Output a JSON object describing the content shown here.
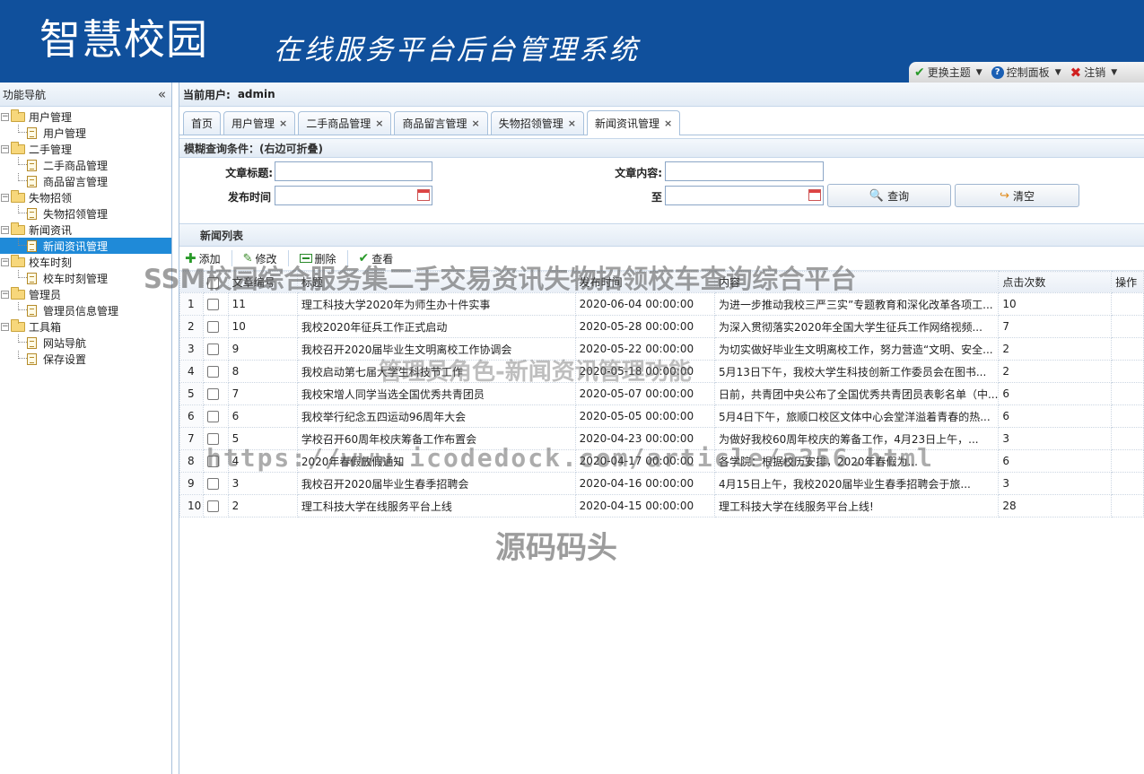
{
  "header": {
    "brand": "智慧校园",
    "subtitle": "在线服务平台后台管理系统",
    "toolbar": {
      "theme": "更换主题",
      "control_panel": "控制面板",
      "logout": "注销"
    }
  },
  "sidebar": {
    "title": "功能导航",
    "collapse": "«",
    "tree": [
      {
        "type": "group",
        "label": "用户管理"
      },
      {
        "type": "leaf",
        "label": "用户管理"
      },
      {
        "type": "group",
        "label": "二手管理"
      },
      {
        "type": "leaf",
        "label": "二手商品管理"
      },
      {
        "type": "leaf",
        "label": "商品留言管理"
      },
      {
        "type": "group",
        "label": "失物招领"
      },
      {
        "type": "leaf",
        "label": "失物招领管理"
      },
      {
        "type": "group",
        "label": "新闻资讯"
      },
      {
        "type": "leaf",
        "label": "新闻资讯管理",
        "selected": true
      },
      {
        "type": "group",
        "label": "校车时刻"
      },
      {
        "type": "leaf",
        "label": "校车时刻管理"
      },
      {
        "type": "group",
        "label": "管理员"
      },
      {
        "type": "leaf",
        "label": "管理员信息管理"
      },
      {
        "type": "group",
        "label": "工具箱"
      },
      {
        "type": "leaf",
        "label": "网站导航"
      },
      {
        "type": "leaf",
        "label": "保存设置"
      }
    ]
  },
  "userbar": {
    "label": "当前用户:",
    "user": "admin"
  },
  "tabs": [
    {
      "label": "首页",
      "closable": false
    },
    {
      "label": "用户管理",
      "closable": true
    },
    {
      "label": "二手商品管理",
      "closable": true
    },
    {
      "label": "商品留言管理",
      "closable": true
    },
    {
      "label": "失物招领管理",
      "closable": true
    },
    {
      "label": "新闻资讯管理",
      "closable": true,
      "active": true
    }
  ],
  "search": {
    "title": "模糊查询条件：(右边可折叠)",
    "title_label": "文章标题:",
    "title_value": "",
    "content_label": "文章内容:",
    "content_value": "",
    "date_label": "发布时间",
    "date_from": "",
    "to_label": "至",
    "date_to": "",
    "query_button": "查询",
    "clear_button": "清空"
  },
  "list": {
    "title": "新闻列表",
    "toolbar": {
      "add": "添加",
      "edit": "修改",
      "delete": "删除",
      "view": "查看"
    },
    "columns": [
      "文章编号",
      "标题",
      "发布时间",
      "内容",
      "点击次数",
      "操作"
    ],
    "rows": [
      {
        "n": "1",
        "id": "11",
        "title": "理工科技大学2020年为师生办十件实事",
        "time": "2020-06-04 00:00:00",
        "content": "为进一步推动我校三严三实”专题教育和深化改革各项工...",
        "clicks": "10"
      },
      {
        "n": "2",
        "id": "10",
        "title": "我校2020年征兵工作正式启动",
        "time": "2020-05-28 00:00:00",
        "content": "为深入贯彻落实2020年全国大学生征兵工作网络视频...",
        "clicks": "7"
      },
      {
        "n": "3",
        "id": "9",
        "title": "我校召开2020届毕业生文明离校工作协调会",
        "time": "2020-05-22 00:00:00",
        "content": "为切实做好毕业生文明离校工作，努力营造“文明、安全...",
        "clicks": "2"
      },
      {
        "n": "4",
        "id": "8",
        "title": "我校启动第七届大学生科技节工作",
        "time": "2020-05-18 00:00:00",
        "content": "5月13日下午，我校大学生科技创新工作委员会在图书...",
        "clicks": "2"
      },
      {
        "n": "5",
        "id": "7",
        "title": "我校宋增人同学当选全国优秀共青团员",
        "time": "2020-05-07 00:00:00",
        "content": "日前，共青团中央公布了全国优秀共青团员表彰名单（中...",
        "clicks": "6"
      },
      {
        "n": "6",
        "id": "6",
        "title": "我校举行纪念五四运动96周年大会",
        "time": "2020-05-05 00:00:00",
        "content": "5月4日下午，旅顺口校区文体中心会堂洋溢着青春的热...",
        "clicks": "6"
      },
      {
        "n": "7",
        "id": "5",
        "title": "学校召开60周年校庆筹备工作布置会",
        "time": "2020-04-23 00:00:00",
        "content": "为做好我校60周年校庆的筹备工作，4月23日上午，...",
        "clicks": "3"
      },
      {
        "n": "8",
        "id": "4",
        "title": "2020年春假放假通知",
        "time": "2020-04-17 00:00:00",
        "content": "各学院：根据校历安排，2020年春假为...",
        "clicks": "6"
      },
      {
        "n": "9",
        "id": "3",
        "title": "我校召开2020届毕业生春季招聘会",
        "time": "2020-04-16 00:00:00",
        "content": "4月15日上午，我校2020届毕业生春季招聘会于旅...",
        "clicks": "3"
      },
      {
        "n": "10",
        "id": "2",
        "title": "理工科技大学在线服务平台上线",
        "time": "2020-04-15 00:00:00",
        "content": "理工科技大学在线服务平台上线!",
        "clicks": "28"
      }
    ]
  },
  "watermarks": {
    "line1": "SSM校园综合服务集二手交易资讯失物招领校车查询综合平台",
    "line2": "管理员角色-新闻资讯管理功能",
    "line3": "https://www.icodedock.com/article/a356.html",
    "line4": "源码码头"
  },
  "colors": {
    "header_bg": "#10509c",
    "selected_bg": "#1f8ad8",
    "border": "#a8c1dc"
  }
}
